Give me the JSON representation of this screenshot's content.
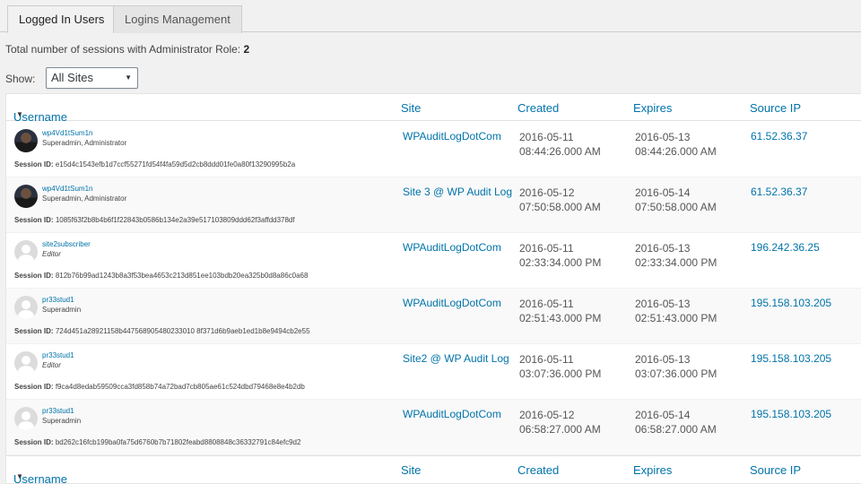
{
  "tabs": [
    {
      "label": "Logged In Users",
      "active": true
    },
    {
      "label": "Logins Management",
      "active": false
    }
  ],
  "summary": {
    "label": "Total number of sessions with Administrator Role:",
    "count": "2"
  },
  "filter": {
    "label": "Show:",
    "selected": "All Sites"
  },
  "columns": {
    "username": "Username",
    "site": "Site",
    "created": "Created",
    "expires": "Expires",
    "source_ip": "Source IP"
  },
  "session_id_label": "Session ID:",
  "rows": [
    {
      "avatar": "photo",
      "username": "wp4Vd1tSum1n",
      "roles": "Superadmin, Administrator",
      "session_id": "e15d4c1543efb1d7ccf55271fd54f4fa59d5d2cb8ddd01fe0a80f13290995b2a",
      "site": "WPAuditLogDotCom",
      "created_date": "2016-05-11",
      "created_time": "08:44:26.000 AM",
      "expires_date": "2016-05-13",
      "expires_time": "08:44:26.000 AM",
      "ip": "61.52.36.37"
    },
    {
      "avatar": "photo",
      "username": "wp4Vd1tSum1n",
      "roles": "Superadmin, Administrator",
      "session_id": "1085f63f2b8b4b6f1f22843b0586b134e2a39e517103809ddd62f3affdd378df",
      "site": "Site 3 @ WP Audit Log",
      "created_date": "2016-05-12",
      "created_time": "07:50:58.000 AM",
      "expires_date": "2016-05-14",
      "expires_time": "07:50:58.000 AM",
      "ip": "61.52.36.37"
    },
    {
      "avatar": "generic",
      "username": "site2subscriber",
      "roles": "Editor",
      "session_id": "812b76b99ad1243b8a3f53bea4653c213d851ee103bdb20ea325b0d8a86c0a68",
      "site": "WPAuditLogDotCom",
      "created_date": "2016-05-11",
      "created_time": "02:33:34.000 PM",
      "expires_date": "2016-05-13",
      "expires_time": "02:33:34.000 PM",
      "ip": "196.242.36.25"
    },
    {
      "avatar": "generic",
      "username": "pr33stud1",
      "roles": "Superadmin",
      "session_id": "724d451a28921158b447568905480233010 8f371d6b9aeb1ed1b8e9494cb2e55",
      "site": "WPAuditLogDotCom",
      "created_date": "2016-05-11",
      "created_time": "02:51:43.000 PM",
      "expires_date": "2016-05-13",
      "expires_time": "02:51:43.000 PM",
      "ip": "195.158.103.205"
    },
    {
      "avatar": "generic",
      "username": "pr33stud1",
      "roles": "Editor",
      "session_id": "f9ca4d8edab59509cca3fd858b74a72bad7cb805ae61c524dbd79468e8e4b2db",
      "site": "Site2 @ WP Audit Log",
      "created_date": "2016-05-11",
      "created_time": "03:07:36.000 PM",
      "expires_date": "2016-05-13",
      "expires_time": "03:07:36.000 PM",
      "ip": "195.158.103.205"
    },
    {
      "avatar": "generic",
      "username": "pr33stud1",
      "roles": "Superadmin",
      "session_id": "bd262c16fcb199ba0fa75d6760b7b71802feabd8808848c36332791c84efc9d2",
      "site": "WPAuditLogDotCom",
      "created_date": "2016-05-12",
      "created_time": "06:58:27.000 AM",
      "expires_date": "2016-05-14",
      "expires_time": "06:58:27.000 AM",
      "ip": "195.158.103.205"
    }
  ]
}
